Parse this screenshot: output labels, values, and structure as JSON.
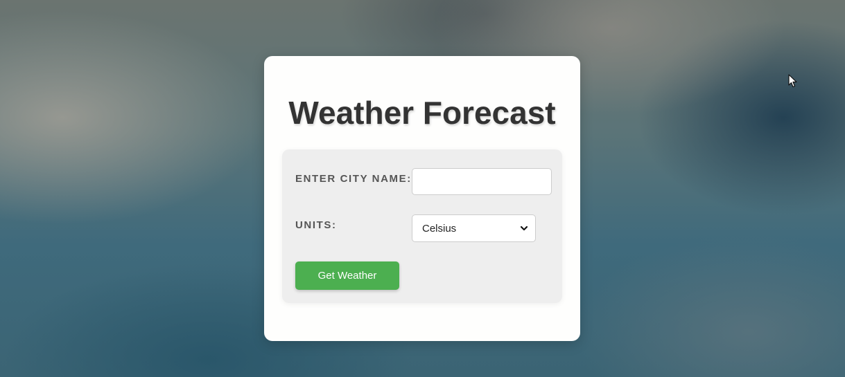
{
  "app": {
    "title": "Weather Forecast"
  },
  "form": {
    "city_label": "ENTER CITY NAME:",
    "city_value": "",
    "city_placeholder": "",
    "units_label": "UNITS:",
    "units_selected": "Celsius",
    "submit_label": "Get Weather"
  },
  "colors": {
    "accent": "#4caf50",
    "card": "#fefefd",
    "panel": "#eeeeee",
    "title_text": "#333333",
    "label_text": "#555555"
  },
  "icons": {
    "select_arrow": "chevron-down-icon",
    "pointer": "mouse-cursor-icon"
  }
}
